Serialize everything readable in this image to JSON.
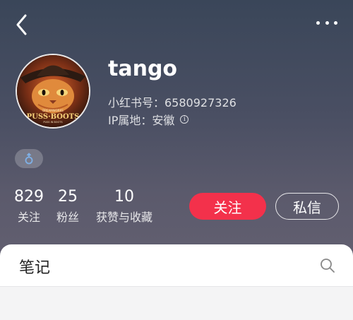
{
  "profile": {
    "username": "tango",
    "id_text": "小红书号：6580927326",
    "ip_text": "IP属地：安徽",
    "avatar": {
      "title_line": "PUSS·BOOTS",
      "studio_line": "DREAMWORKS",
      "tagline": "PUSS IN BOOTS"
    }
  },
  "stats": [
    {
      "num": "829",
      "label": "关注"
    },
    {
      "num": "25",
      "label": "粉丝"
    },
    {
      "num": "10",
      "label": "获赞与收藏"
    }
  ],
  "actions": {
    "follow_label": "关注",
    "message_label": "私信"
  },
  "tabs": {
    "notes_label": "笔记"
  },
  "colors": {
    "follow_bg": "#f3314b",
    "gender_icon": "#7fb0e6"
  },
  "icons": {
    "back": "back-arrow-icon",
    "more": "more-dots-icon",
    "info": "info-icon",
    "gender": "male-icon",
    "search": "search-icon"
  }
}
